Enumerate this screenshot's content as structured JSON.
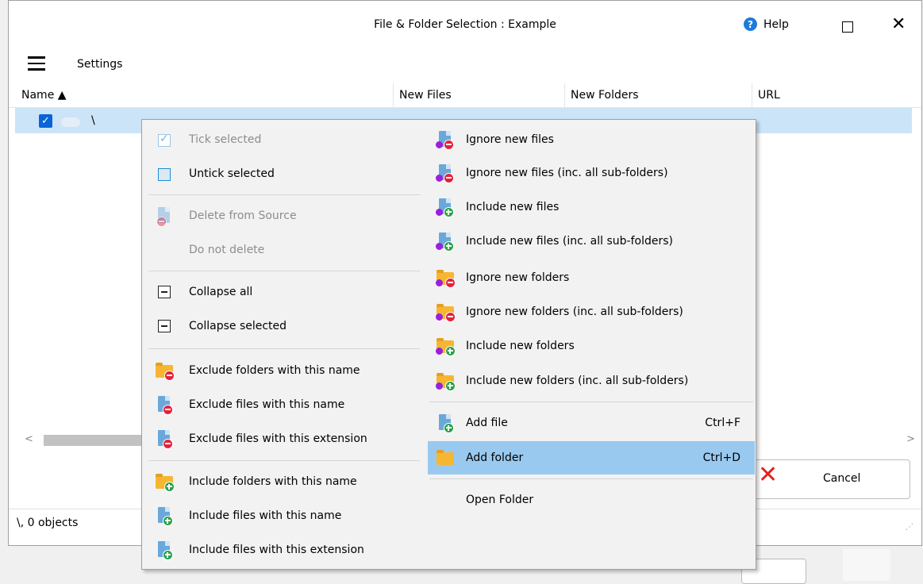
{
  "window": {
    "title": "File & Folder Selection : Example",
    "help_label": "Help",
    "settings_label": "Settings"
  },
  "columns": [
    "Name ▲",
    "New Files",
    "New Folders",
    "URL"
  ],
  "row": {
    "name": "\\"
  },
  "buttons": {
    "cancel": "Cancel"
  },
  "status": "\\, 0 objects",
  "menu": {
    "left": [
      {
        "label": "Tick selected",
        "disabled": true,
        "icon": "checkbox-checked-icon"
      },
      {
        "label": "Untick selected",
        "disabled": false,
        "icon": "checkbox-unchecked-icon"
      },
      {
        "label": "Delete from Source",
        "disabled": true,
        "icon": "file-delete-icon"
      },
      {
        "label": "Do not delete",
        "disabled": true,
        "icon": ""
      },
      {
        "label": "Collapse all",
        "disabled": false,
        "icon": "collapse-icon"
      },
      {
        "label": "Collapse selected",
        "disabled": false,
        "icon": "collapse-icon"
      },
      {
        "label": "Exclude folders with this name",
        "disabled": false,
        "icon": "folder-exclude-icon"
      },
      {
        "label": "Exclude files with this name",
        "disabled": false,
        "icon": "file-exclude-icon"
      },
      {
        "label": "Exclude files with this extension",
        "disabled": false,
        "icon": "file-ext-exclude-icon"
      },
      {
        "label": "Include folders with this name",
        "disabled": false,
        "icon": "folder-include-icon"
      },
      {
        "label": "Include files with this name",
        "disabled": false,
        "icon": "file-include-icon"
      },
      {
        "label": "Include files with this extension",
        "disabled": false,
        "icon": "file-ext-include-icon"
      }
    ],
    "right": [
      {
        "label": "Ignore new files",
        "icon": "file-ignore-icon"
      },
      {
        "label": "Ignore new files (inc. all sub-folders)",
        "icon": "file-ignore-icon"
      },
      {
        "label": "Include new files",
        "icon": "file-include-new-icon"
      },
      {
        "label": "Include new files (inc. all sub-folders)",
        "icon": "file-include-new-icon"
      },
      {
        "label": "Ignore new folders",
        "icon": "folder-ignore-icon"
      },
      {
        "label": "Ignore new folders (inc. all sub-folders)",
        "icon": "folder-ignore-icon"
      },
      {
        "label": "Include new folders",
        "icon": "folder-include-new-icon"
      },
      {
        "label": "Include new folders (inc. all sub-folders)",
        "icon": "folder-include-new-icon"
      },
      {
        "label": "Add file",
        "shortcut": "Ctrl+F",
        "icon": "add-file-icon"
      },
      {
        "label": "Add folder",
        "shortcut": "Ctrl+D",
        "icon": "add-folder-icon",
        "highlighted": true
      },
      {
        "label": "Open Folder",
        "icon": ""
      }
    ]
  }
}
